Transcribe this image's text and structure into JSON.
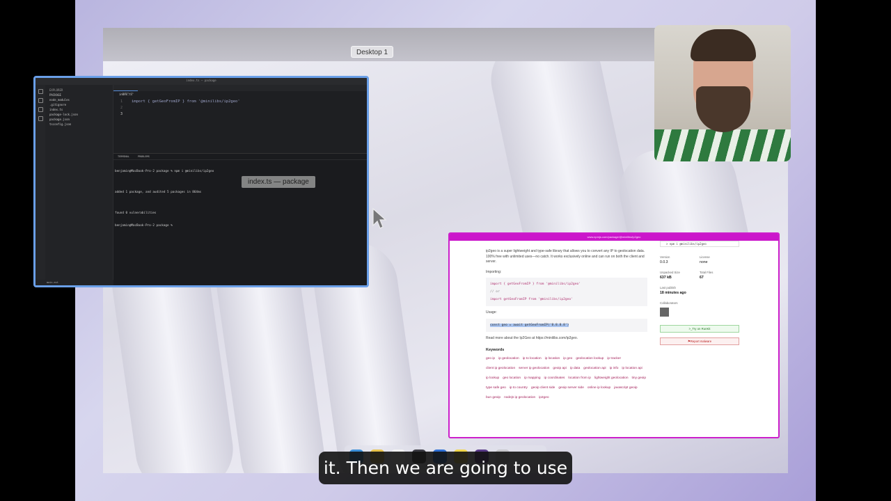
{
  "mission_control": {
    "desktop_label": "Desktop 1",
    "window_label": "index.ts — package"
  },
  "vscode": {
    "title": "index.ts — package",
    "explorer_label": "EXPLORER",
    "folder": "PACKAGE",
    "files": [
      "node_modules",
      ".gitignore",
      "index.ts",
      "package-lock.json",
      "package.json",
      "tsconfig.json"
    ],
    "tab": "index.ts",
    "breadcrumb": "index.ts",
    "line_numbers": [
      "1",
      "2",
      "3"
    ],
    "code_line1": "import { getGeoFromIP } from '@minilibs/ip2geo'",
    "terminal_tabs": [
      "TERMINAL",
      "PROBLEMS"
    ],
    "terminal_lines": [
      "benjamin@MacBook-Pro-2 package % npm i @minilibs/ip2geo",
      "",
      "added 1 package, and audited 5 packages in 864ms",
      "",
      "found 0 vulnerabilities",
      "benjamin@MacBook-Pro-2 package %"
    ],
    "status": "main.ext"
  },
  "browser": {
    "url": "www.npmjs.com/package/@minilibs/ip2geo",
    "description": "ip2geo is a super lightweight and type-safe library that allows you to convert any IP to geolocation data. 100% free with unlimited uses—no catch. It works exclusively online and can run on both the client and server.",
    "importing_label": "Importing:",
    "import1": "import { getGeoFromIP } from '@minilibs/ip2geo'",
    "or_comment": "// or",
    "import2": "import getGeoFromIP from '@minilibs/ip2geo'",
    "usage_label": "Usage:",
    "usage_code": "const geo = await getGeoFromIP('8.8.8.8')",
    "read_more": "Read more about the Ip2Geo at https://minilibs.com/ip2geo.",
    "keywords_title": "Keywords",
    "keywords": [
      "geo ip",
      "ip geolocation",
      "ip to location",
      "ip location",
      "ip geo",
      "geolocation lookup",
      "ip tracker",
      "client ip geolocation",
      "server ip geolocation",
      "geoip api",
      "ip data",
      "geolocation api",
      "ip info",
      "ip location api",
      "ip lookup",
      "geo location",
      "ip mapping",
      "ip coordinates",
      "location from ip",
      "lightweight geolocation",
      "tiny geoip",
      "type safe geo",
      "ip to country",
      "geoip client side",
      "geoip server side",
      "online ip lookup",
      "javascript geoip",
      "bun geoip",
      "nodejs ip geolocation",
      "ip2geo"
    ],
    "install_cmd": "> npm i @minilibs/ip2geo",
    "version_label": "Version",
    "version": "0.0.3",
    "license_label": "License",
    "license": "none",
    "unpacked_label": "Unpacked Size",
    "unpacked": "637 kB",
    "files_label": "Total Files",
    "files": "67",
    "publish_label": "Last publish",
    "publish": "18 minutes ago",
    "collab_label": "Collaborators",
    "runkit": ">_Try on RunKit",
    "report": "⚑Report malware"
  },
  "caption": "it. Then we are going to use"
}
